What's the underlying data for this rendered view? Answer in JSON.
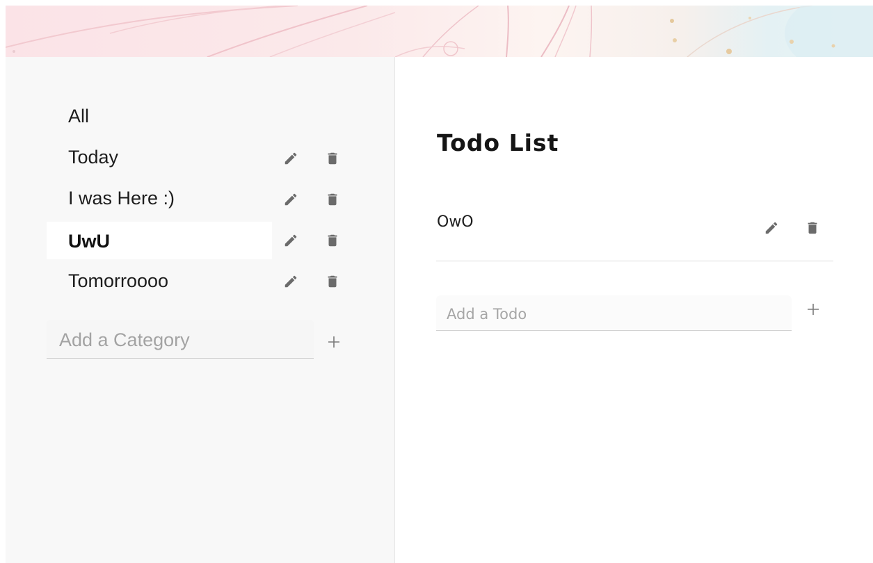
{
  "sidebar": {
    "categories": [
      {
        "label": "All",
        "editable": false,
        "selected": false
      },
      {
        "label": "Today",
        "editable": true,
        "selected": false
      },
      {
        "label": "I was Here :)",
        "editable": true,
        "selected": false
      },
      {
        "label": "UwU",
        "editable": true,
        "selected": true
      },
      {
        "label": "Tomorroooo",
        "editable": true,
        "selected": false
      }
    ],
    "add_category_placeholder": "Add a Category",
    "add_category_value": ""
  },
  "main": {
    "title": "Todo List",
    "todos": [
      {
        "text": "OwO"
      }
    ],
    "add_todo_placeholder": "Add a Todo",
    "add_todo_value": ""
  },
  "icons": {
    "edit": "pencil-icon",
    "delete": "trash-icon",
    "add": "plus-icon"
  },
  "colors": {
    "sidebar_bg": "#f8f8f8",
    "selected_bg": "#ffffff",
    "icon": "#6b6b6b",
    "text": "#1d1d1d",
    "placeholder": "#a3a3a3"
  }
}
